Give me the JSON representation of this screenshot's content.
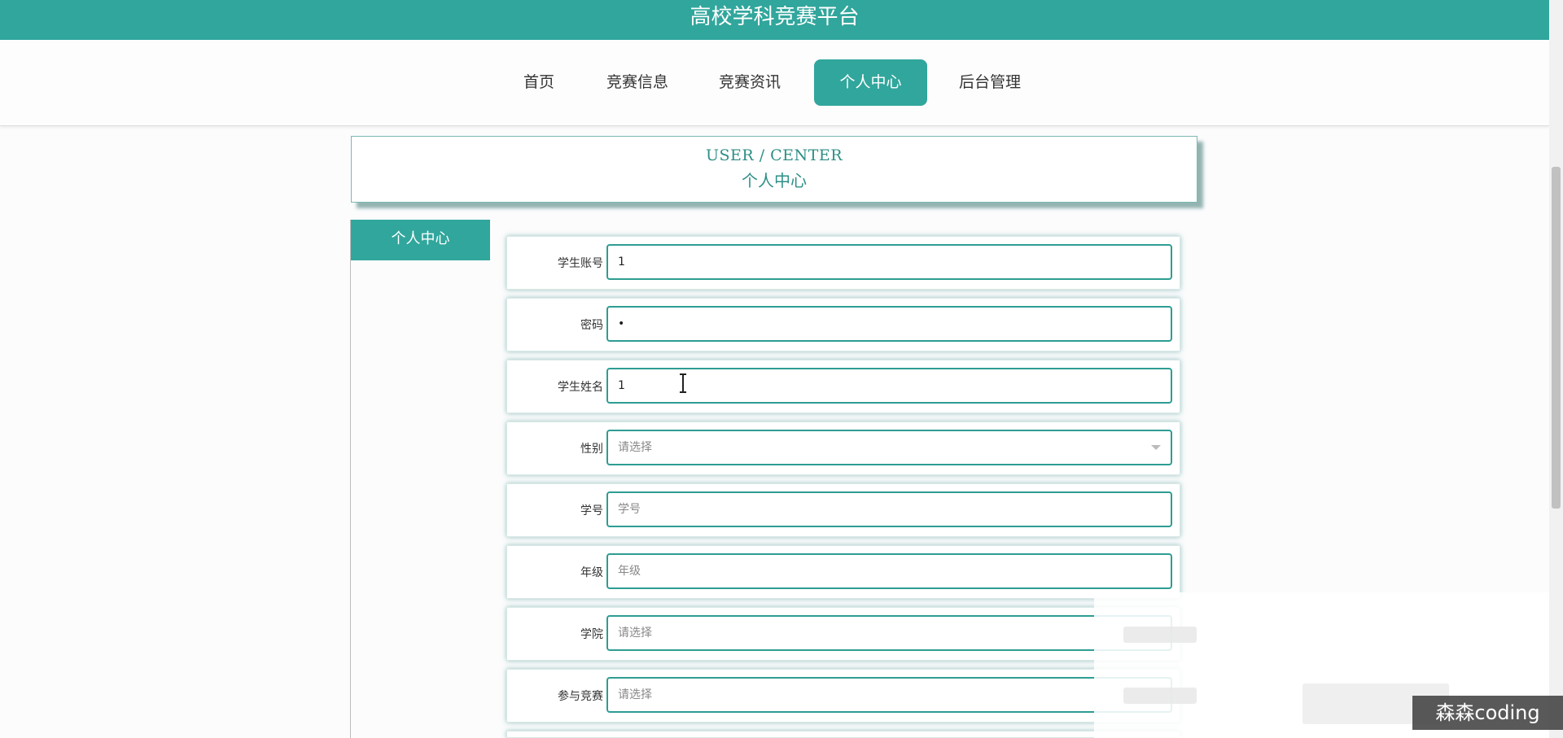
{
  "app": {
    "title": "高校学科竞赛平台"
  },
  "nav": {
    "items": [
      {
        "label": "首页"
      },
      {
        "label": "竞赛信息"
      },
      {
        "label": "竞赛资讯"
      },
      {
        "label": "个人中心",
        "active": true
      },
      {
        "label": "后台管理"
      }
    ]
  },
  "header": {
    "en": "USER / CENTER",
    "cn": "个人中心"
  },
  "sidebar": {
    "title": "个人中心"
  },
  "form": {
    "rows": [
      {
        "label": "学生账号",
        "value": "1",
        "type": "text"
      },
      {
        "label": "密码",
        "value": "•",
        "type": "password"
      },
      {
        "label": "学生姓名",
        "value": "1",
        "type": "text"
      },
      {
        "label": "性别",
        "value": "请选择",
        "type": "select"
      },
      {
        "label": "学号",
        "value": "学号",
        "type": "placeholder"
      },
      {
        "label": "年级",
        "value": "年级",
        "type": "placeholder"
      },
      {
        "label": "学院",
        "value": "请选择",
        "type": "select"
      },
      {
        "label": "参与竞赛",
        "value": "请选择",
        "type": "select"
      }
    ]
  },
  "watermark": {
    "text": "森森coding"
  },
  "colors": {
    "accent": "#31a69c",
    "text": "#333333"
  }
}
